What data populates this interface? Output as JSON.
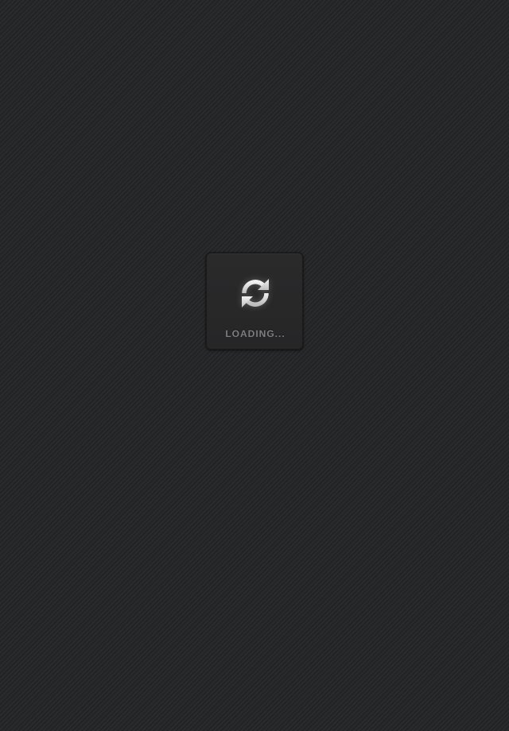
{
  "loader": {
    "icon": "refresh-icon",
    "label": "LOADING..."
  },
  "colors": {
    "background": "#262728",
    "panel": "#282829",
    "icon": "#d8d8d8",
    "label": "#7d7e7f"
  }
}
